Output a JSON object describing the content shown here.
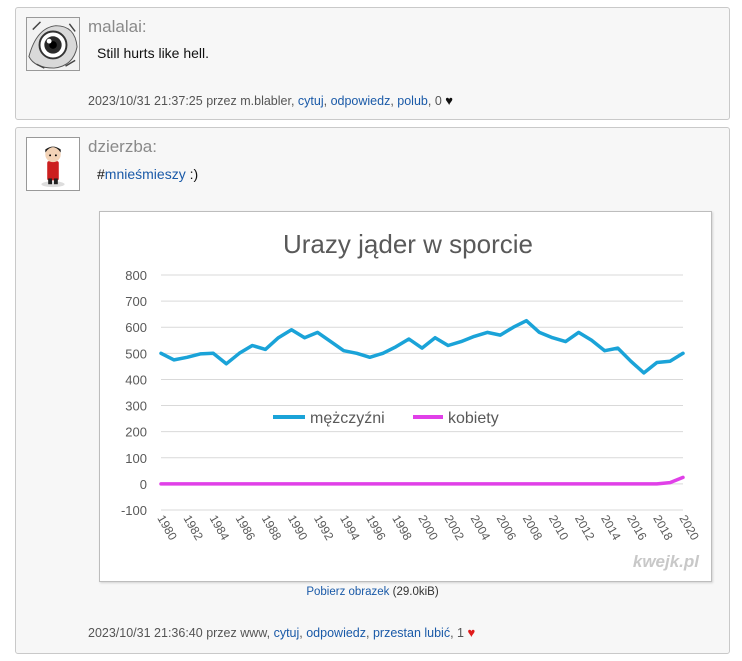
{
  "comments": [
    {
      "author": "malalai:",
      "text": "Still hurts like hell.",
      "meta": {
        "datetime": "2023/10/31 21:37:25",
        "by": "przez m.blabler,",
        "quote": "cytuj",
        "reply": "odpowiedz",
        "like": "polub",
        "count": "0"
      }
    },
    {
      "author": "dzierzba:",
      "text_prefix": "#",
      "hashtag": "mnieśmieszy",
      "text_suffix": " :)",
      "download": {
        "link": "Pobierz obrazek",
        "size": "(29.0kiB)"
      },
      "meta": {
        "datetime": "2023/10/31 21:36:40",
        "by": "przez www,",
        "quote": "cytuj",
        "reply": "odpowiedz",
        "like": "przestan lubić",
        "count": "1"
      }
    }
  ],
  "image_watermark": "kwejk.pl",
  "chart_data": {
    "type": "line",
    "title": "Urazy jąder w sporcie",
    "xlabel": "",
    "ylabel": "",
    "ylim": [
      -100,
      800
    ],
    "yticks": [
      800,
      700,
      600,
      500,
      400,
      300,
      200,
      100,
      0,
      -100
    ],
    "xticks": [
      "1980",
      "1982",
      "1984",
      "1986",
      "1988",
      "1990",
      "1992",
      "1994",
      "1996",
      "1998",
      "2000",
      "2002",
      "2004",
      "2006",
      "2008",
      "2010",
      "2012",
      "2014",
      "2016",
      "2018",
      "2020"
    ],
    "xlim": [
      1980,
      2020
    ],
    "grid": true,
    "legend_position": "center",
    "series": [
      {
        "name": "mężczyźni",
        "color": "#1aa3d8",
        "x": [
          1980,
          1981,
          1982,
          1983,
          1984,
          1985,
          1986,
          1987,
          1988,
          1989,
          1990,
          1991,
          1992,
          1993,
          1994,
          1995,
          1996,
          1997,
          1998,
          1999,
          2000,
          2001,
          2002,
          2003,
          2004,
          2005,
          2006,
          2007,
          2008,
          2009,
          2010,
          2011,
          2012,
          2013,
          2014,
          2015,
          2016,
          2017,
          2018,
          2019,
          2020
        ],
        "values": [
          500,
          475,
          485,
          498,
          500,
          460,
          500,
          530,
          515,
          560,
          590,
          560,
          580,
          545,
          510,
          500,
          485,
          500,
          525,
          555,
          520,
          560,
          530,
          545,
          565,
          580,
          570,
          600,
          625,
          580,
          560,
          545,
          580,
          550,
          510,
          520,
          470,
          425,
          465,
          470,
          500
        ]
      },
      {
        "name": "kobiety",
        "color": "#e040e8",
        "x": [
          1980,
          1985,
          1990,
          1995,
          2000,
          2005,
          2010,
          2015,
          2018,
          2019,
          2020
        ],
        "values": [
          0,
          0,
          0,
          0,
          0,
          0,
          0,
          0,
          0,
          5,
          25
        ]
      }
    ]
  }
}
